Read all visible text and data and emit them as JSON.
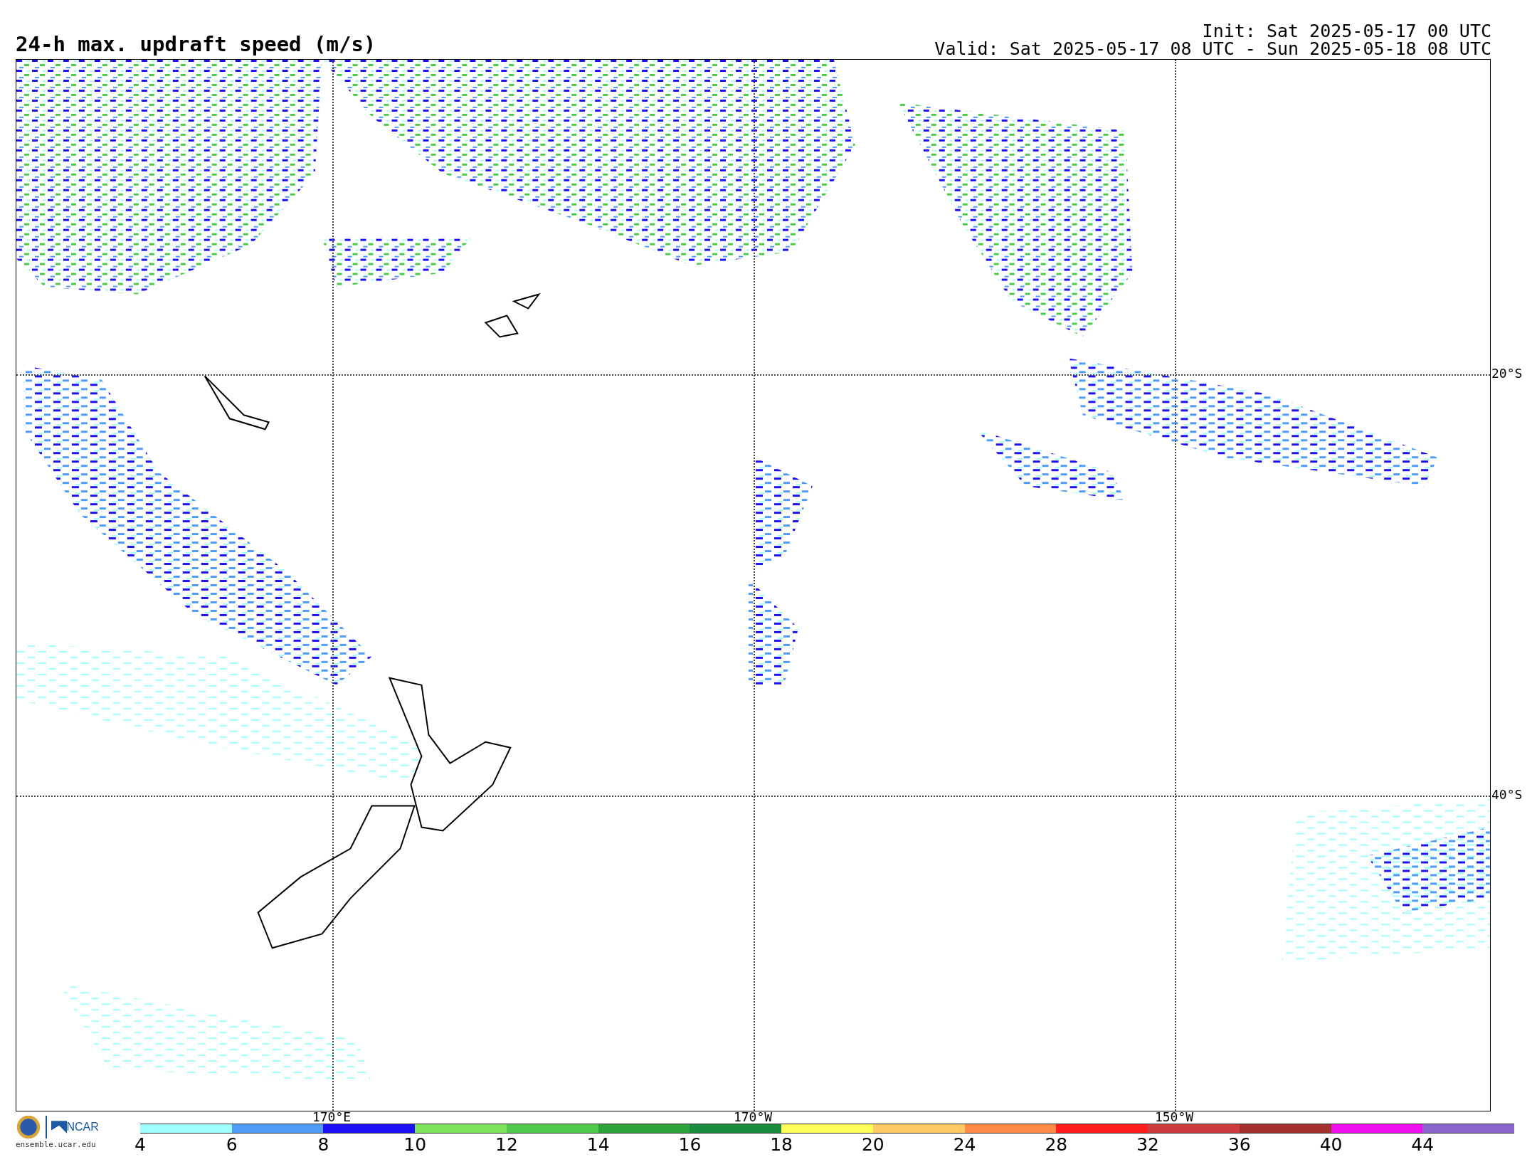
{
  "title": "24-h max. updraft speed (m/s)",
  "init": "Init: Sat 2025-05-17 00 UTC",
  "valid": "Valid: Sat 2025-05-17 08 UTC - Sun 2025-05-18 08 UTC",
  "map": {
    "lat_labels": [
      "20°S",
      "40°S"
    ],
    "lon_labels": [
      "170°E",
      "170°W",
      "150°W"
    ]
  },
  "logos": {
    "ncar": "NCAR",
    "url": "ensemble.ucar.edu"
  },
  "colorbar": {
    "bins": [
      {
        "tick": "4",
        "color": "#a0ffff"
      },
      {
        "tick": "6",
        "color": "#4f9bf5"
      },
      {
        "tick": "8",
        "color": "#1e10f5"
      },
      {
        "tick": "10",
        "color": "#7ce35b"
      },
      {
        "tick": "12",
        "color": "#4ec94a"
      },
      {
        "tick": "14",
        "color": "#2ba43b"
      },
      {
        "tick": "16",
        "color": "#1b8b3e"
      },
      {
        "tick": "18",
        "color": "#ffff5a"
      },
      {
        "tick": "20",
        "color": "#ffc966"
      },
      {
        "tick": "24",
        "color": "#ff8a47"
      },
      {
        "tick": "28",
        "color": "#ff1e1e"
      },
      {
        "tick": "32",
        "color": "#cc3c3c"
      },
      {
        "tick": "36",
        "color": "#a3302d"
      },
      {
        "tick": "40",
        "color": "#ee10ee"
      },
      {
        "tick": "44",
        "color": "#8a66cc"
      }
    ]
  }
}
